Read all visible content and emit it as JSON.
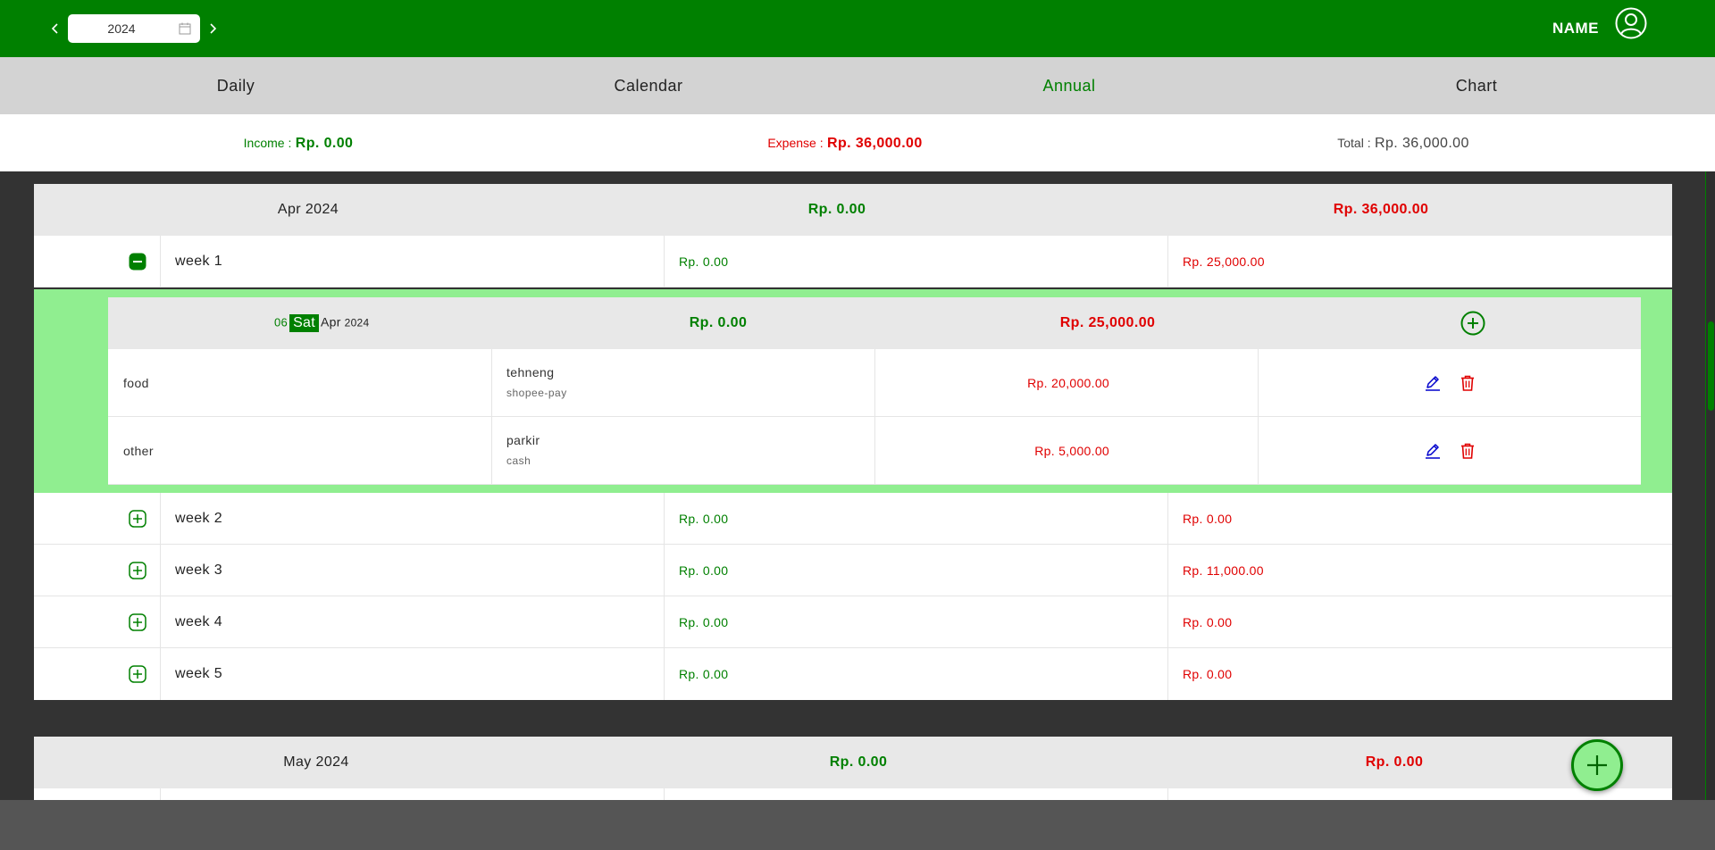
{
  "header": {
    "year_value": "2024",
    "user_name": "NAME"
  },
  "tabs": [
    {
      "label": "Daily",
      "active": false
    },
    {
      "label": "Calendar",
      "active": false
    },
    {
      "label": "Annual",
      "active": true
    },
    {
      "label": "Chart",
      "active": false
    }
  ],
  "summary": {
    "income_label": "Income :",
    "income_value": "Rp. 0.00",
    "expense_label": "Expense :",
    "expense_value": "Rp. 36,000.00",
    "total_label": "Total :",
    "total_value": "Rp. 36,000.00"
  },
  "months": [
    {
      "label": "Apr 2024",
      "income": "Rp. 0.00",
      "expense": "Rp. 36,000.00",
      "weeks": [
        {
          "label": "week 1",
          "income": "Rp. 0.00",
          "expense": "Rp. 25,000.00",
          "expanded": true
        },
        {
          "label": "week 2",
          "income": "Rp. 0.00",
          "expense": "Rp. 0.00",
          "expanded": false
        },
        {
          "label": "week 3",
          "income": "Rp. 0.00",
          "expense": "Rp. 11,000.00",
          "expanded": false
        },
        {
          "label": "week 4",
          "income": "Rp. 0.00",
          "expense": "Rp. 0.00",
          "expanded": false
        },
        {
          "label": "week 5",
          "income": "Rp. 0.00",
          "expense": "Rp. 0.00",
          "expanded": false
        }
      ]
    },
    {
      "label": "May 2024",
      "income": "Rp. 0.00",
      "expense": "Rp. 0.00"
    }
  ],
  "day": {
    "day_num": "06",
    "weekday": "Sat",
    "month": "Apr",
    "year": "2024",
    "income": "Rp. 0.00",
    "expense": "Rp. 25,000.00",
    "transactions": [
      {
        "category": "food",
        "note": "tehneng",
        "account": "shopee-pay",
        "amount": "Rp. 20,000.00"
      },
      {
        "category": "other",
        "note": "parkir",
        "account": "cash",
        "amount": "Rp. 5,000.00"
      }
    ]
  },
  "colors": {
    "primary": "#008000",
    "highlight": "#90ee90",
    "income": "#008000",
    "expense": "#e00000",
    "edit": "#0000cc"
  }
}
